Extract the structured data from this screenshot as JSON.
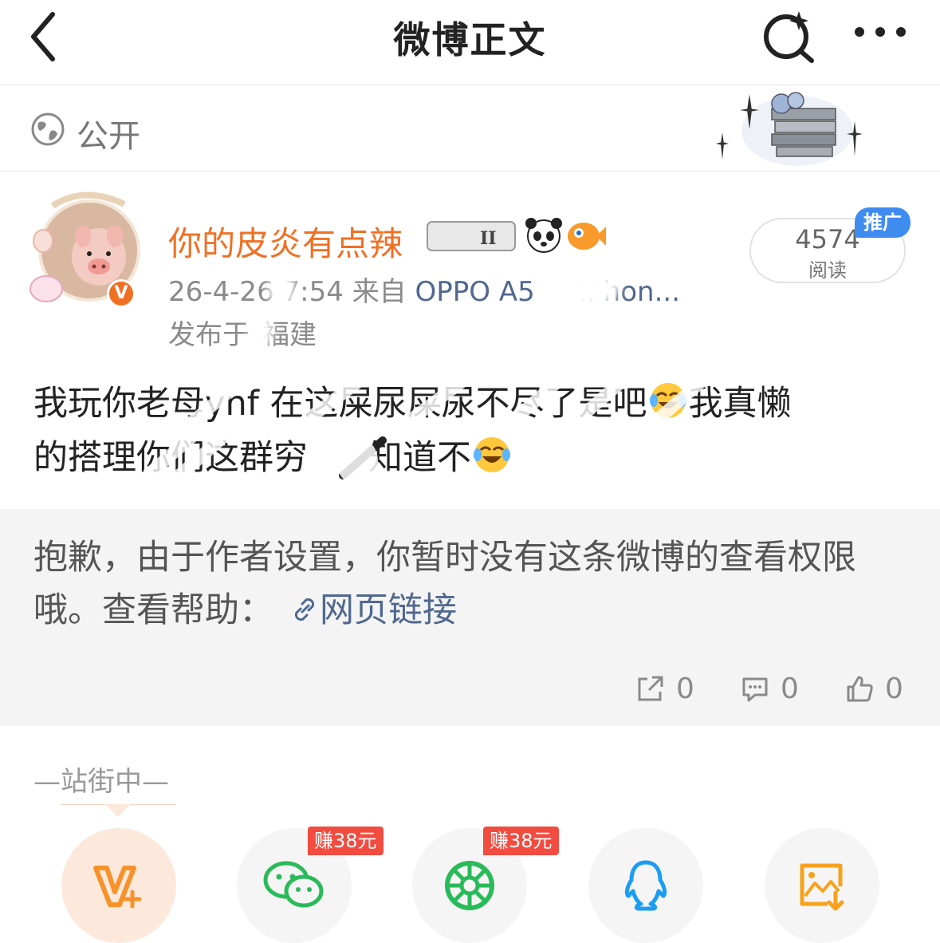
{
  "header": {
    "title": "微博正文",
    "back_icon": "chevron-left-icon",
    "search_icon": "search-sparkle-icon",
    "more_icon": "more-dots-icon"
  },
  "visibility": {
    "label": "公开",
    "icon": "globe-icon"
  },
  "author": {
    "name": "你的皮炎有点辣",
    "verified_badge": "V",
    "time": "26-4-26 ",
    "time_end": "7:54",
    "source_prefix": "来自",
    "source_start": "OPPO A5",
    "source_end": "iPhon...",
    "location_prefix": "发布于",
    "location": "福建"
  },
  "read_stats": {
    "count": "4574",
    "label": "阅读",
    "promo_tag": "推广"
  },
  "post": {
    "line1": "我玩你老母ynf 在这屎尿屎尿不尽了是吧",
    "line1b": "我真懒",
    "line2a": "的搭理",
    "line2b": "你们这群穷",
    "line2c": "知道不"
  },
  "notice": {
    "text": "抱歉，由于作者设置，你暂时没有这条微博的查看权限哦。查看帮助：",
    "link": "网页链接"
  },
  "stats": {
    "reposts": "0",
    "comments": "0",
    "likes": "0"
  },
  "share": {
    "heading": "—站街中—",
    "earn_wechat": "赚38元",
    "earn_moments": "赚38元",
    "targets": [
      "vplus-icon",
      "wechat-icon",
      "moments-icon",
      "qq-icon",
      "save-image-icon"
    ]
  },
  "colors": {
    "accent_orange": "#f07023",
    "link_blue": "#50688f",
    "promo_blue": "#3f8cf0",
    "earn_red": "#f24b3f"
  }
}
